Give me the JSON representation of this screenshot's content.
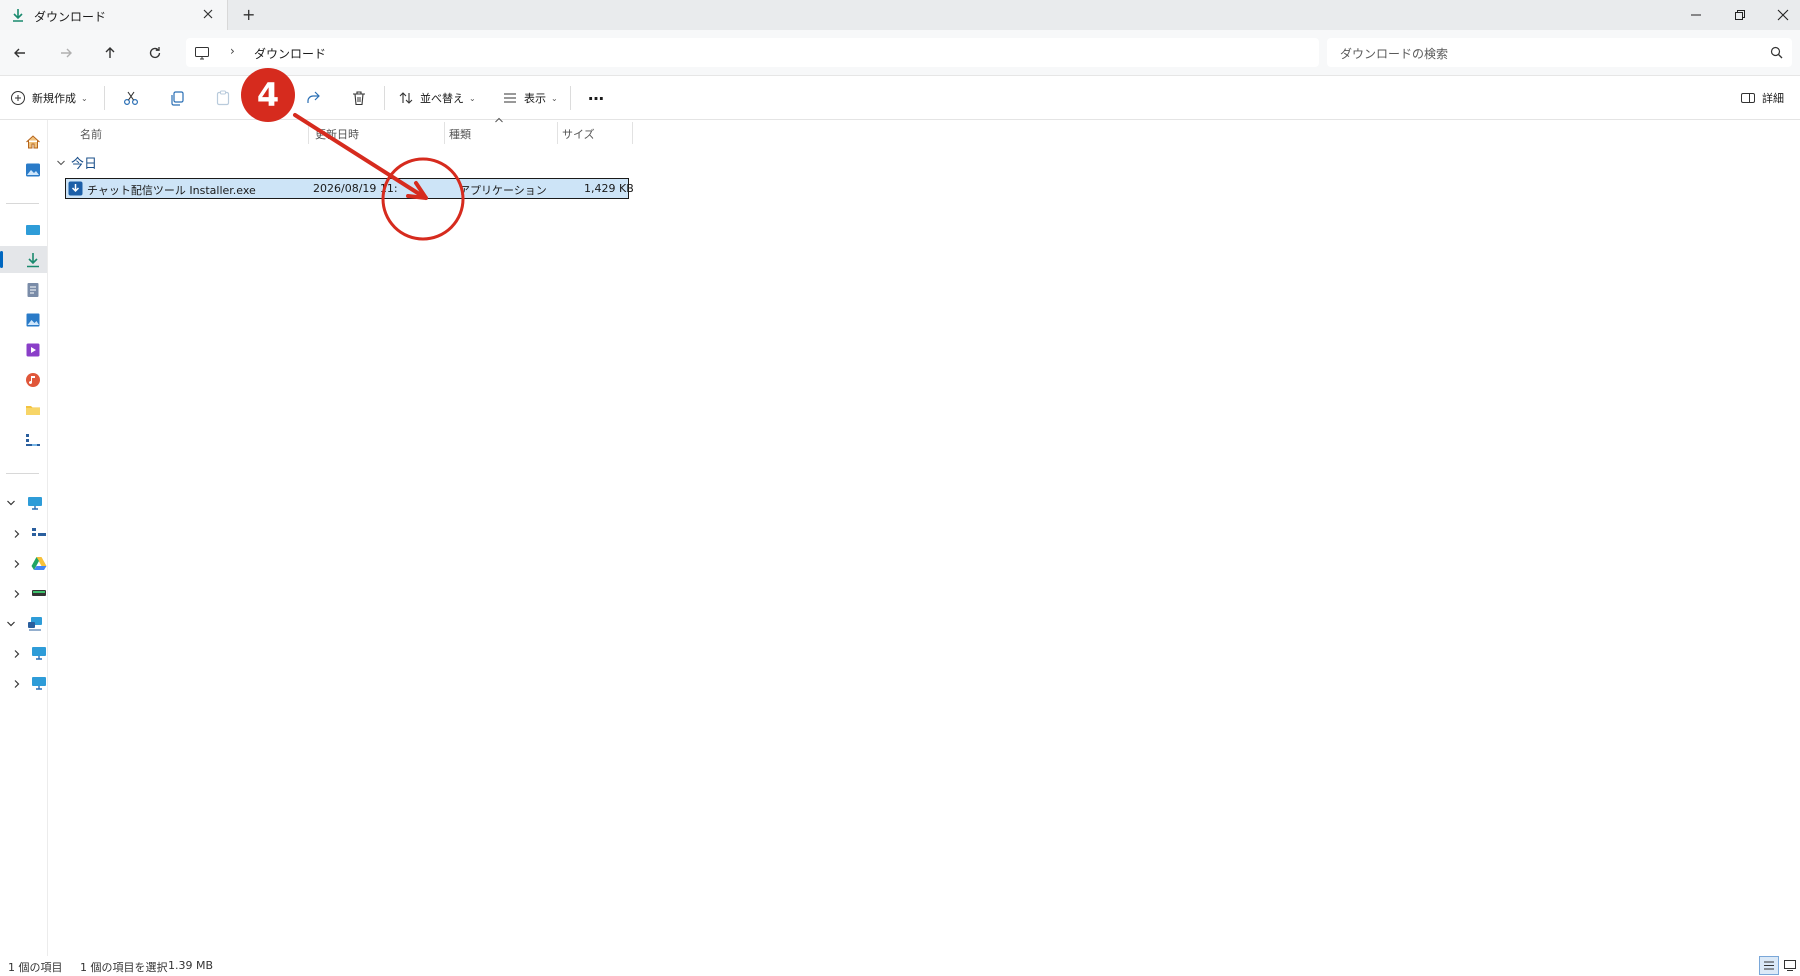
{
  "window": {
    "tab_title": "ダウンロード",
    "new_tab": "+"
  },
  "address": {
    "breadcrumb": "ダウンロード",
    "search_placeholder": "ダウンロードの検索"
  },
  "toolbar": {
    "new_label": "新規作成",
    "sort_label": "並べ替え",
    "view_label": "表示",
    "more_label": "…",
    "details_label": "詳細"
  },
  "columns": {
    "name": "名前",
    "date": "更新日時",
    "type": "種類",
    "size": "サイズ"
  },
  "group": {
    "label": "今日"
  },
  "file": {
    "name": "チャット配信ツール Installer.exe",
    "date": "2026/08/19 11:",
    "type": "アプリケーション",
    "size": "1,429 KB"
  },
  "annotation": {
    "step_number": "4",
    "color": "#d62b1e"
  },
  "status": {
    "item_count": "1 個の項目",
    "selected": "1 個の項目を選択",
    "selected_size": "1.39 MB"
  },
  "colors": {
    "selection": "#cde4f7",
    "accent": "#0067c0"
  }
}
